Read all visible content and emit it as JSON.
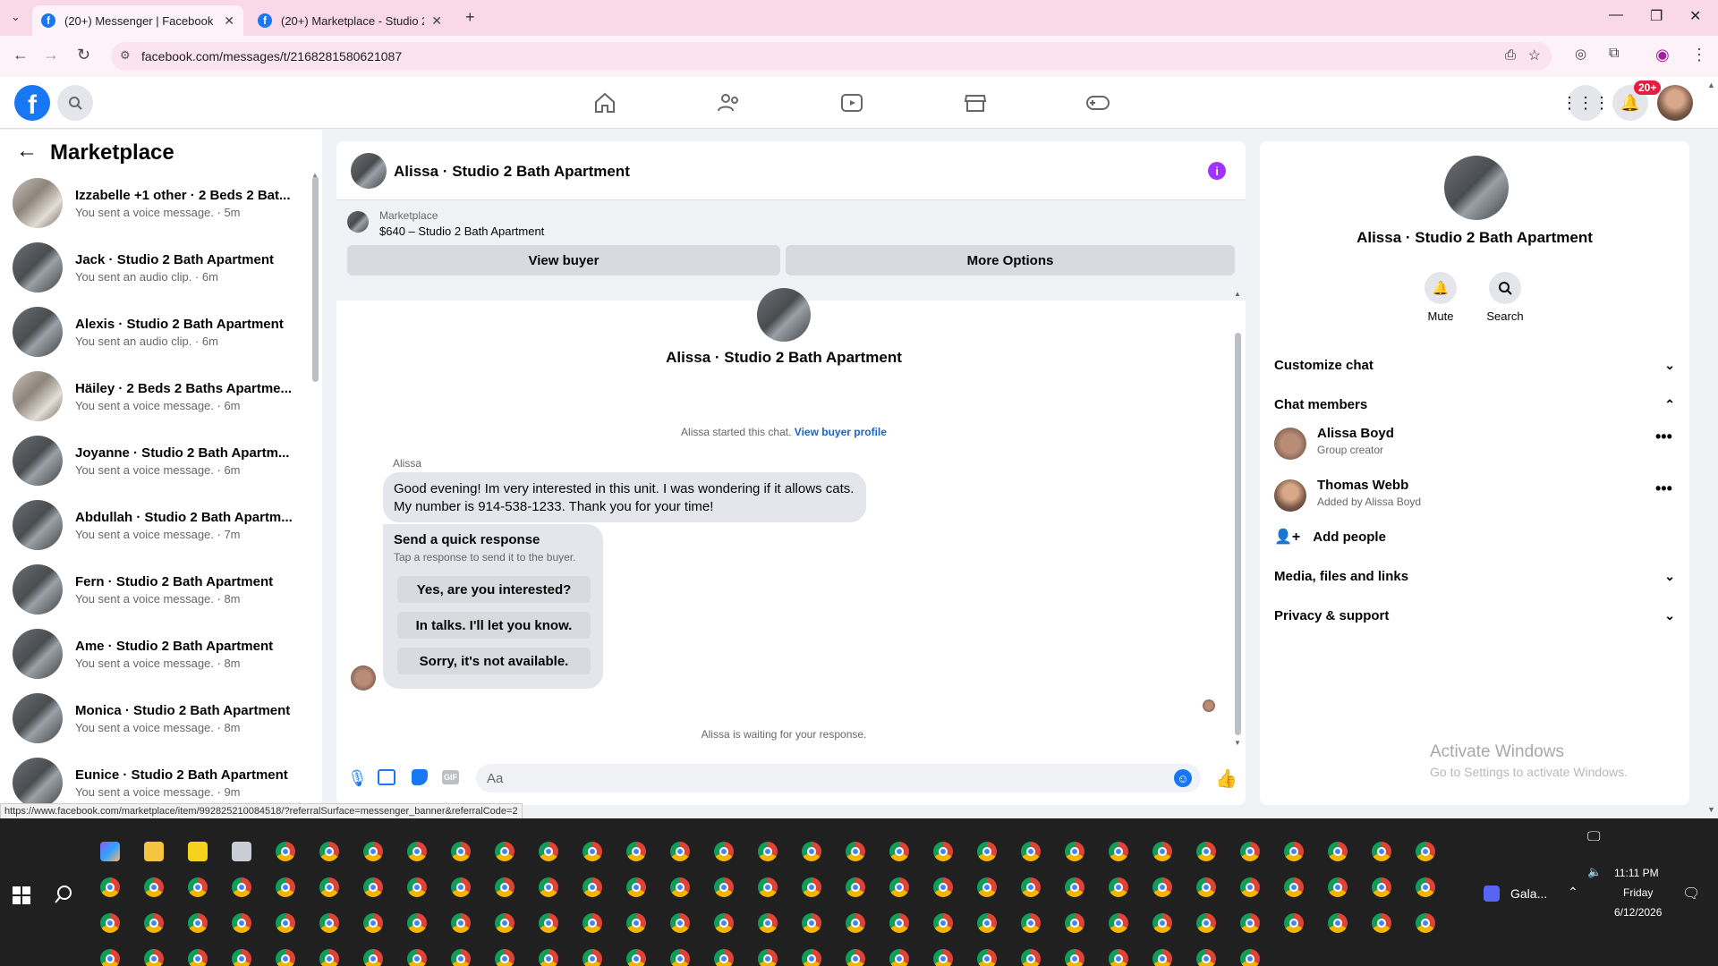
{
  "browser": {
    "tabs": [
      {
        "title": "(20+) Messenger | Facebook",
        "active": true
      },
      {
        "title": "(20+) Marketplace - Studio 2 B",
        "active": false
      }
    ],
    "url": "facebook.com/messages/t/2168281580621087",
    "status_url": "https://www.facebook.com/marketplace/item/992825210084518/?referralSurface=messenger_banner&referralCode=2"
  },
  "header": {
    "logo": "f",
    "notification_badge": "20+",
    "nav_icons": [
      "home-icon",
      "friends-icon",
      "watch-icon",
      "marketplace-icon",
      "gaming-icon"
    ],
    "accent": "#1877f2"
  },
  "sidebar": {
    "title": "Marketplace",
    "conversations": [
      {
        "name": "Izzabelle +1 other · 2 Beds 2 Bat...",
        "sub": "You sent a voice message. · 5m"
      },
      {
        "name": "Jack · Studio 2 Bath Apartment",
        "sub": "You sent an audio clip. · 6m"
      },
      {
        "name": "Alexis · Studio 2 Bath Apartment",
        "sub": "You sent an audio clip. · 6m"
      },
      {
        "name": "Häiley · 2 Beds 2 Baths Apartme...",
        "sub": "You sent a voice message. · 6m"
      },
      {
        "name": "Joyanne · Studio 2 Bath Apartm...",
        "sub": "You sent a voice message. · 6m"
      },
      {
        "name": "Abdullah · Studio 2 Bath Apartm...",
        "sub": "You sent a voice message. · 7m"
      },
      {
        "name": "Fern · Studio 2 Bath Apartment",
        "sub": "You sent a voice message. · 8m"
      },
      {
        "name": "Ame · Studio 2 Bath Apartment",
        "sub": "You sent a voice message. · 8m"
      },
      {
        "name": "Monica · Studio 2 Bath Apartment",
        "sub": "You sent a voice message. · 8m"
      },
      {
        "name": "Eunice · Studio 2 Bath Apartment",
        "sub": "You sent a voice message. · 9m"
      }
    ]
  },
  "chat": {
    "title": "Alissa · Studio 2 Bath Apartment",
    "banner_label": "Marketplace",
    "banner_item": "$640 – Studio 2 Bath Apartment",
    "view_buyer": "View buyer",
    "more_options": "More Options",
    "profile_name": "Alissa · Studio 2 Bath Apartment",
    "started_text": "Alissa started this chat.",
    "view_profile_link": "View buyer profile",
    "sender": "Alissa",
    "message": "Good evening! Im very interested in this unit. I was wondering if it allows cats. My number is 914-538-1233. Thank you for your time!",
    "quick_title": "Send a quick response",
    "quick_sub": "Tap a response to send it to the buyer.",
    "quick_replies": [
      "Yes, are you interested?",
      "In talks. I'll let you know.",
      "Sorry, it's not available."
    ],
    "waiting": "Alissa is waiting for your response.",
    "input_placeholder": "Aa"
  },
  "info": {
    "name": "Alissa · Studio 2 Bath Apartment",
    "mute": "Mute",
    "search": "Search",
    "customize": "Customize chat",
    "members_title": "Chat members",
    "members": [
      {
        "name": "Alissa Boyd",
        "sub": "Group creator"
      },
      {
        "name": "Thomas Webb",
        "sub": "Added by Alissa Boyd"
      }
    ],
    "add_people": "Add people",
    "media": "Media, files and links",
    "privacy": "Privacy & support",
    "watermark_title": "Activate Windows",
    "watermark_sub": "Go to Settings to activate Windows."
  },
  "taskbar": {
    "time": "11:11 PM",
    "day": "Friday",
    "date": "6/12/2026",
    "app_label": "Gala..."
  }
}
